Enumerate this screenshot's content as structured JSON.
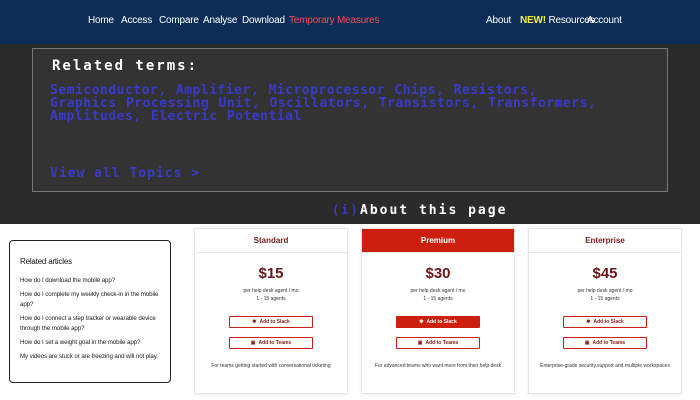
{
  "nav": {
    "left": [
      "Home",
      "Access",
      "Compare",
      "Analyse",
      "Download",
      "Temporary Measures"
    ],
    "about": "About",
    "new_badge": "NEW!",
    "resources": "Resources",
    "account": "Account"
  },
  "banner": {
    "title": "Related terms:",
    "terms": "Semiconductor, Amplifier, Microprocessor Chips, Resistors, Graphics Processing Unit, Oscillators, Transistors, Transformers, Amplitudes, Electric Potential",
    "view_all": "View all Topics  >",
    "about_icon": "info-icon",
    "about_label": "About this page"
  },
  "articles": {
    "title": "Related articles",
    "items": [
      "How do I download the mobile app?",
      "How do I complete my weekly check-in in the mobile app?",
      "How do I connect a step tracker or wearable device through the mobile app?",
      "How do I set a weight goal in the mobile app?",
      "My videos are stuck or are freezing and will not play."
    ]
  },
  "plans": [
    {
      "name": "Standard",
      "price": "$15",
      "per": "per help desk agent / mo",
      "agents": "1 - 15 agents",
      "slack": "Add to Slack",
      "teams": "Add to Teams",
      "desc": "For teams getting started with conversational ticketing"
    },
    {
      "name": "Premium",
      "price": "$30",
      "per": "per help desk agent / mo",
      "agents": "1 - 15 agents",
      "slack": "Add to Slack",
      "teams": "Add to Teams",
      "desc": "For advanced teams who want more from their help desk"
    },
    {
      "name": "Enterprise",
      "price": "$45",
      "per": "per help desk agent / mo",
      "agents": "1 - 15 agents",
      "slack": "Add to Slack",
      "teams": "Add to Teams",
      "desc": "Enterprise-grade security,support and multiple workspaces"
    }
  ],
  "colors": {
    "nav_bg": "#0c2d57",
    "active_nav": "#ff4b4b",
    "new_badge": "#ffe94a",
    "accent_red": "#cc1f0e",
    "term_blue": "#3a3ac8"
  }
}
